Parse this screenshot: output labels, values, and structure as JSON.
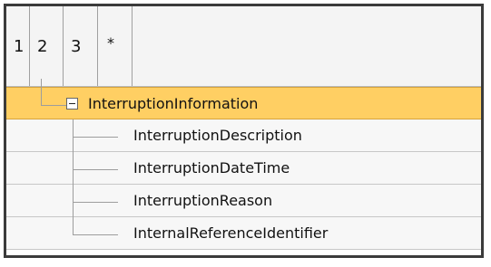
{
  "header": {
    "columns": [
      "1",
      "2",
      "3",
      "*"
    ]
  },
  "tree": {
    "parent": {
      "label": "InterruptionInformation",
      "expanded_symbol": "−"
    },
    "children": [
      "InterruptionDescription",
      "InterruptionDateTime",
      "InterruptionReason",
      "InternalReferenceIdentifier"
    ]
  },
  "colors": {
    "selected_row": "#ffcf63",
    "border": "#3b3b3b",
    "tree_lines": "#9d9d9d"
  }
}
